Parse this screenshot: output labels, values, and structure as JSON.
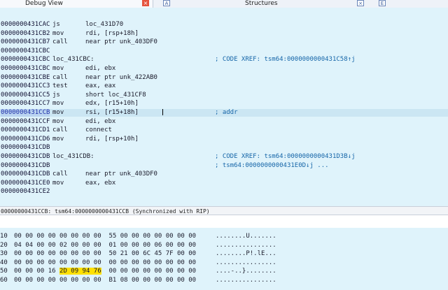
{
  "tabs": {
    "debug_view": "Debug View",
    "structures": "Structures",
    "close_glyph": "×",
    "a_glyph": "A",
    "enum_glyph": "E"
  },
  "disasm": [
    {
      "addr": "0000000431CAC",
      "mn": "js",
      "op": "loc_431D70",
      "label": "",
      "cmt": ""
    },
    {
      "addr": "0000000431CB2",
      "mn": "mov",
      "op": "rdi, [rsp+18h]",
      "label": "",
      "cmt": ""
    },
    {
      "addr": "0000000431CB7",
      "mn": "call",
      "op": "near ptr unk_403DF0",
      "label": "",
      "cmt": ""
    },
    {
      "addr": "0000000431CBC",
      "mn": "",
      "op": "",
      "label": "",
      "cmt": ""
    },
    {
      "addr": "0000000431CBC",
      "mn": "",
      "op": "",
      "label": "loc_431CBC:",
      "cmt": "; CODE XREF: tsm64:0000000000431C58↑j"
    },
    {
      "addr": "0000000431CBC",
      "mn": "mov",
      "op": "edi, ebx",
      "label": "",
      "cmt": ""
    },
    {
      "addr": "0000000431CBE",
      "mn": "call",
      "op": "near ptr unk_422AB0",
      "label": "",
      "cmt": ""
    },
    {
      "addr": "0000000431CC3",
      "mn": "test",
      "op": "eax, eax",
      "label": "",
      "cmt": ""
    },
    {
      "addr": "0000000431CC5",
      "mn": "js",
      "op": "short loc_431CF8",
      "label": "",
      "cmt": ""
    },
    {
      "addr": "0000000431CC7",
      "mn": "mov",
      "op": "edx, [r15+10h]",
      "label": "",
      "cmt": ""
    },
    {
      "addr": "0000000431CCB",
      "mn": "mov",
      "op": "rsi, [r15+18h]",
      "label": "",
      "cmt": "; addr",
      "current": true
    },
    {
      "addr": "0000000431CCF",
      "mn": "mov",
      "op": "edi, ebx",
      "label": "",
      "cmt": ""
    },
    {
      "addr": "0000000431CD1",
      "mn": "call",
      "op": "connect",
      "label": "",
      "cmt": ""
    },
    {
      "addr": "0000000431CD6",
      "mn": "mov",
      "op": "rdi, [rsp+10h]",
      "label": "",
      "cmt": ""
    },
    {
      "addr": "0000000431CDB",
      "mn": "",
      "op": "",
      "label": "",
      "cmt": ""
    },
    {
      "addr": "0000000431CDB",
      "mn": "",
      "op": "",
      "label": "loc_431CDB:",
      "cmt": "; CODE XREF: tsm64:0000000000431D3B↓j"
    },
    {
      "addr": "0000000431CDB",
      "mn": "",
      "op": "",
      "label": "",
      "cmt": "; tsm64:0000000000431E0D↓j ..."
    },
    {
      "addr": "0000000431CDB",
      "mn": "call",
      "op": "near ptr unk_403DF0",
      "label": "",
      "cmt": ""
    },
    {
      "addr": "0000000431CE0",
      "mn": "mov",
      "op": "eax, ebx",
      "label": "",
      "cmt": ""
    },
    {
      "addr": "0000000431CE2",
      "mn": "",
      "op": "",
      "label": "",
      "cmt": ""
    }
  ],
  "status": "00000000431CCB: tsm64:0000000000431CCB (Synchronized with RIP)",
  "hex": [
    {
      "addr": "10",
      "pre": "00 00 00 00 00 00 00 00  55 00 00 00 00 00 00 00",
      "hl": "",
      "post": "",
      "ascii": "........U......."
    },
    {
      "addr": "20",
      "pre": "04 04 00 00 02 00 00 00  01 00 00 00 06 00 00 00",
      "hl": "",
      "post": "",
      "ascii": "................"
    },
    {
      "addr": "30",
      "pre": "00 00 00 00 00 00 00 00  50 21 00 6C 45 7F 00 00",
      "hl": "",
      "post": "",
      "ascii": "........P!.lE..."
    },
    {
      "addr": "40",
      "pre": "00 00 00 00 00 00 00 00  00 00 00 00 00 00 00 00",
      "hl": "",
      "post": "",
      "ascii": "................"
    },
    {
      "addr": "50",
      "pre": "00 00 00 16 ",
      "hl": "2D 09 94 76",
      "post": "  00 00 00 00 00 00 00 00",
      "ascii": "....-..}........"
    },
    {
      "addr": "60",
      "pre": "00 00 00 00 00 00 00 00  B1 08 00 00 00 00 00 00",
      "hl": "",
      "post": "",
      "ascii": "................"
    }
  ]
}
